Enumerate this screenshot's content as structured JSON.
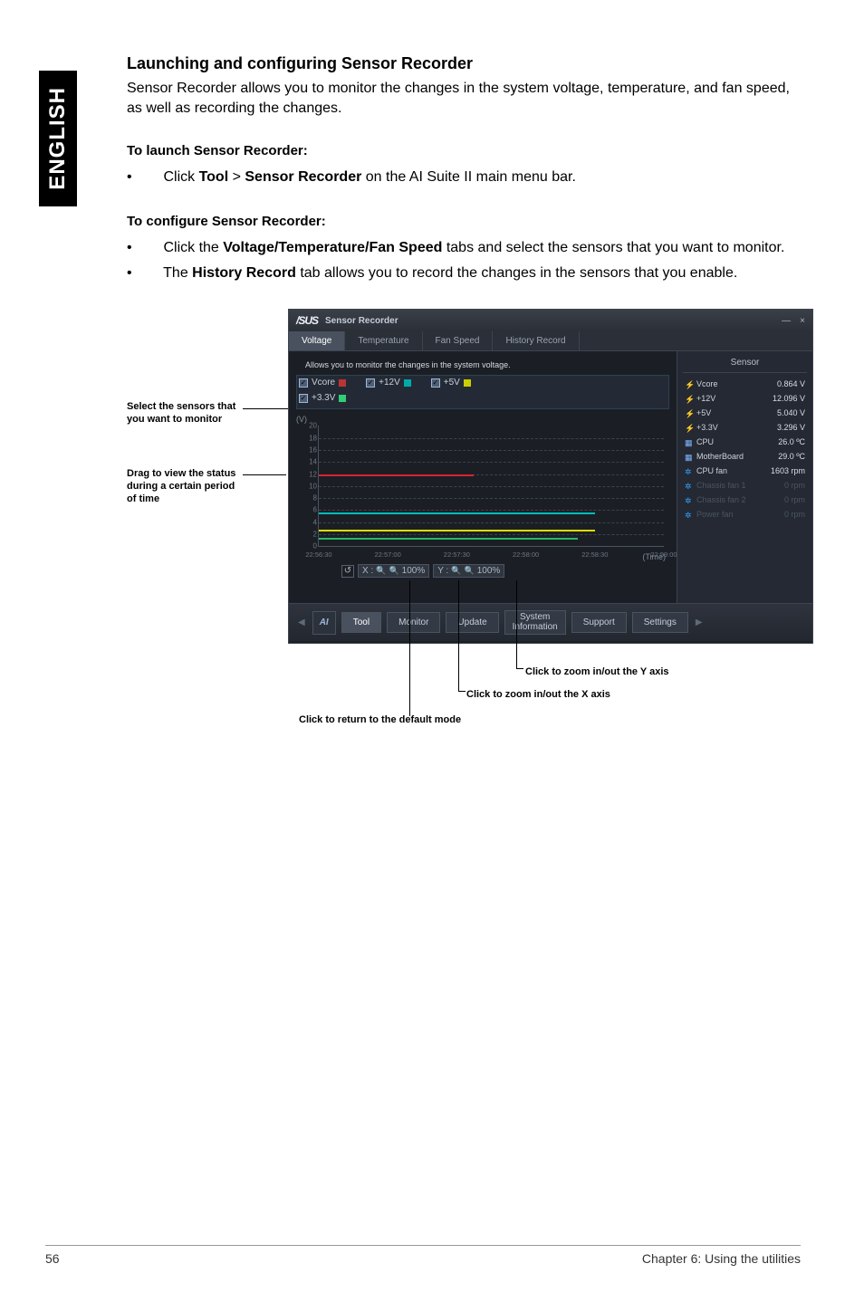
{
  "sideTab": "ENGLISH",
  "title": "Launching and configuring Sensor Recorder",
  "intro": "Sensor Recorder allows you to monitor the changes in the system voltage, temperature, and fan speed, as well as recording the changes.",
  "launch": {
    "heading": "To launch Sensor Recorder:",
    "bullet_pre": "Click ",
    "bullet_tool": "Tool",
    "bullet_gt": " > ",
    "bullet_sr": "Sensor Recorder",
    "bullet_post": " on the AI Suite II main menu bar."
  },
  "configure": {
    "heading": "To configure Sensor Recorder:",
    "b1_pre": "Click the ",
    "b1_bold": "Voltage/Temperature/Fan Speed",
    "b1_post": " tabs and select the sensors that you want to monitor.",
    "b2_pre": "The ",
    "b2_bold": "History Record",
    "b2_post": " tab allows you to record the changes in the sensors that you enable."
  },
  "callouts": {
    "left1": "Select the sensors that you want to monitor",
    "left2": "Drag to view the status during a certain period of time",
    "b1": "Click to zoom in/out the Y axis",
    "b2": "Click to zoom in/out the X axis",
    "b3": "Click to return to the default mode"
  },
  "window": {
    "logo": "/SUS",
    "title": "Sensor Recorder",
    "min": "—",
    "close": "×",
    "tabs": {
      "voltage": "Voltage",
      "temperature": "Temperature",
      "fan": "Fan Speed",
      "history": "History Record"
    },
    "hint": "Allows you to monitor the changes in the system voltage.",
    "checks": {
      "vcore": "Vcore",
      "p12v": "+12V",
      "p5v": "+5V",
      "p33v": "+3.3V"
    },
    "y_unit": "(V)",
    "x_unit": "(Time)",
    "zoom": {
      "xlabel": "X :",
      "ylabel": "Y :",
      "xval": "100%",
      "yval": "100%",
      "reset": "↺"
    },
    "sensorHeader": "Sensor",
    "sensors": [
      {
        "icon": "bolt",
        "name": "Vcore",
        "value": "0.864 V"
      },
      {
        "icon": "bolt",
        "name": "+12V",
        "value": "12.096 V"
      },
      {
        "icon": "bolt",
        "name": "+5V",
        "value": "5.040 V"
      },
      {
        "icon": "bolt",
        "name": "+3.3V",
        "value": "3.296 V"
      },
      {
        "icon": "chip",
        "name": "CPU",
        "value": "26.0 ºC"
      },
      {
        "icon": "chip",
        "name": "MotherBoard",
        "value": "29.0 ºC"
      },
      {
        "icon": "fan",
        "name": "CPU fan",
        "value": "1603 rpm"
      },
      {
        "icon": "fan",
        "name": "Chassis fan 1",
        "value": "0 rpm",
        "dim": true
      },
      {
        "icon": "fan",
        "name": "Chassis fan 2",
        "value": "0 rpm",
        "dim": true
      },
      {
        "icon": "fan",
        "name": "Power fan",
        "value": "0 rpm",
        "dim": true
      }
    ],
    "menubar": {
      "ai": "AI",
      "tool": "Tool",
      "monitor": "Monitor",
      "update": "Update",
      "sysinfo": "System\nInformation",
      "support": "Support",
      "settings": "Settings"
    }
  },
  "chart_data": {
    "type": "line",
    "xlabel": "(Time)",
    "ylabel": "(V)",
    "ylim": [
      0,
      20
    ],
    "y_ticks": [
      0,
      2,
      4,
      6,
      8,
      10,
      12,
      14,
      16,
      18,
      20
    ],
    "x_ticks": [
      "22:56:30",
      "22:57:00",
      "22:57:30",
      "22:58:00",
      "22:58:30",
      "22:59:00"
    ],
    "series": [
      {
        "name": "Vcore",
        "color": "#d23",
        "approx_value": 12
      },
      {
        "name": "+12V",
        "color": "#0bb",
        "approx_value": 5
      },
      {
        "name": "+5V",
        "color": "#dd0",
        "approx_value": 3.3
      },
      {
        "name": "+3.3V",
        "color": "#2b6",
        "approx_value": 0.9
      }
    ]
  },
  "footer": {
    "page": "56",
    "chapter": "Chapter 6: Using the utilities"
  }
}
